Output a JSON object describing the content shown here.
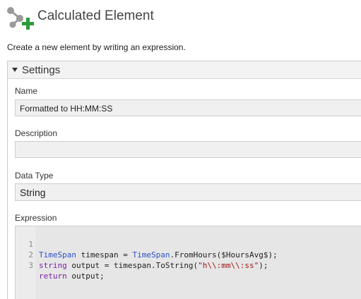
{
  "header": {
    "title": "Calculated Element",
    "icon": "calculated-element-icon"
  },
  "intro_text": "Create a new element by writing an expression.",
  "settings": {
    "title": "Settings",
    "expanded": true,
    "name": {
      "label": "Name",
      "value": "Formatted to HH:MM:SS"
    },
    "description": {
      "label": "Description",
      "value": ""
    },
    "data_type": {
      "label": "Data Type",
      "value": "String"
    },
    "expression": {
      "label": "Expression",
      "lines": [
        {
          "number": "1",
          "tokens": [
            {
              "text": "TimeSpan",
              "kind": "type"
            },
            {
              "text": " timespan = ",
              "kind": "plain"
            },
            {
              "text": "TimeSpan",
              "kind": "type"
            },
            {
              "text": ".FromHours($HoursAvg$);",
              "kind": "plain"
            }
          ]
        },
        {
          "number": "2",
          "tokens": [
            {
              "text": "string",
              "kind": "kw"
            },
            {
              "text": " output = timespan.ToString(",
              "kind": "plain"
            },
            {
              "text": "\"h\\\\:mm\\\\:ss\"",
              "kind": "str"
            },
            {
              "text": ");",
              "kind": "plain"
            }
          ]
        },
        {
          "number": "3",
          "tokens": [
            {
              "text": "return",
              "kind": "kw"
            },
            {
              "text": " output;",
              "kind": "plain"
            }
          ]
        }
      ]
    }
  },
  "colors": {
    "icon_gray": "#9a9a9a",
    "icon_green": "#2e9a3a",
    "type_token": "#2b50c8",
    "keyword_token": "#7a1fa2",
    "string_token": "#a31515"
  }
}
